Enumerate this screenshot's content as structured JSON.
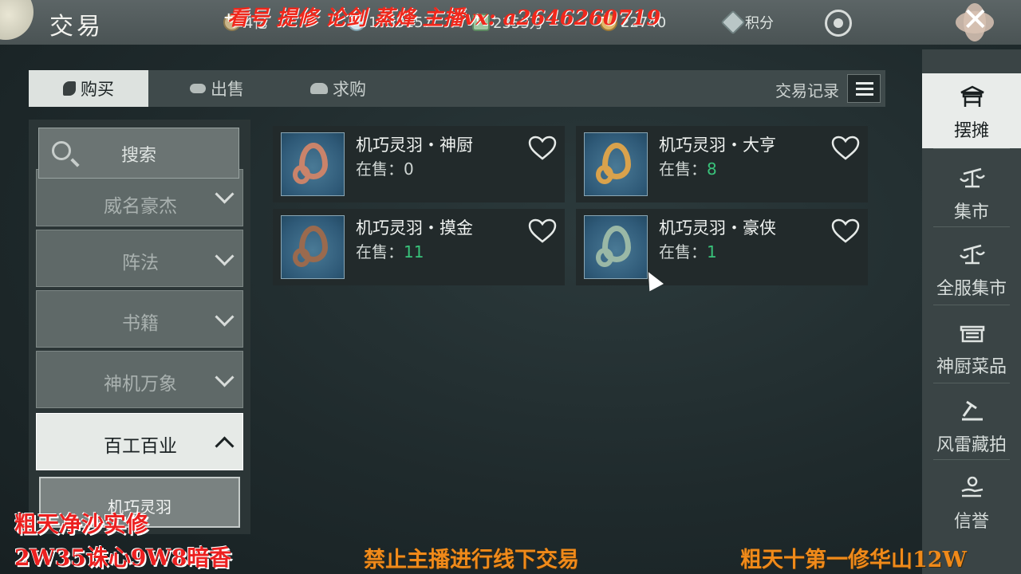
{
  "header": {
    "title": "交易",
    "currencies": [
      {
        "icon": "silver-coin-icon",
        "value": "4亿"
      },
      {
        "icon": "pearl-icon",
        "value": "1739157"
      },
      {
        "icon": "jade-ticket-icon",
        "value": "2353万"
      },
      {
        "icon": "gold-ingot-icon",
        "value": "22740"
      },
      {
        "icon": "points-gem-icon",
        "value": "积分"
      }
    ],
    "watermark": "看号 提修 论剑 蒸烽 主播vx: a2646260719"
  },
  "tabs": {
    "buy": "购买",
    "sell": "出售",
    "request": "求购",
    "records": "交易记录"
  },
  "sidebar": {
    "search_label": "搜索",
    "categories": [
      {
        "label": "威名豪杰",
        "expanded": false
      },
      {
        "label": "阵法",
        "expanded": false
      },
      {
        "label": "书籍",
        "expanded": false
      },
      {
        "label": "神机万象",
        "expanded": false
      },
      {
        "label": "百工百业",
        "expanded": true
      }
    ],
    "subcategory": "机巧灵羽"
  },
  "items": [
    {
      "name": "机巧灵羽・神厨",
      "stock_label": "在售：",
      "stock": "0",
      "color": "#c9836a"
    },
    {
      "name": "机巧灵羽・大亨",
      "stock_label": "在售：",
      "stock": "8",
      "color": "#d9a24c"
    },
    {
      "name": "机巧灵羽・摸金",
      "stock_label": "在售：",
      "stock": "11",
      "color": "#9a6a4e"
    },
    {
      "name": "机巧灵羽・豪侠",
      "stock_label": "在售：",
      "stock": "1",
      "color": "#9ab8a6"
    }
  ],
  "rightnav": [
    {
      "label": "摆摊",
      "icon": "stall-icon",
      "active": true
    },
    {
      "label": "集市",
      "icon": "scale-icon",
      "active": false
    },
    {
      "label": "全服集市",
      "icon": "scale-icon",
      "active": false
    },
    {
      "label": "神厨菜品",
      "icon": "food-stall-icon",
      "active": false
    },
    {
      "label": "风雷藏拍",
      "icon": "gavel-icon",
      "active": false
    },
    {
      "label": "信誉",
      "icon": "reputation-hand-icon",
      "active": false
    }
  ],
  "overlays": {
    "bottom_left_1": "粗天净沙实修",
    "bottom_left_2": "2W35诛心9W8暗香",
    "bottom_center": "禁止主播进行线下交易",
    "bottom_right": "粗天十第一修华山12W"
  },
  "colors": {
    "stock_green": "#39c27a",
    "overlay_red": "#ec2020",
    "overlay_orange": "#f08a1a"
  }
}
